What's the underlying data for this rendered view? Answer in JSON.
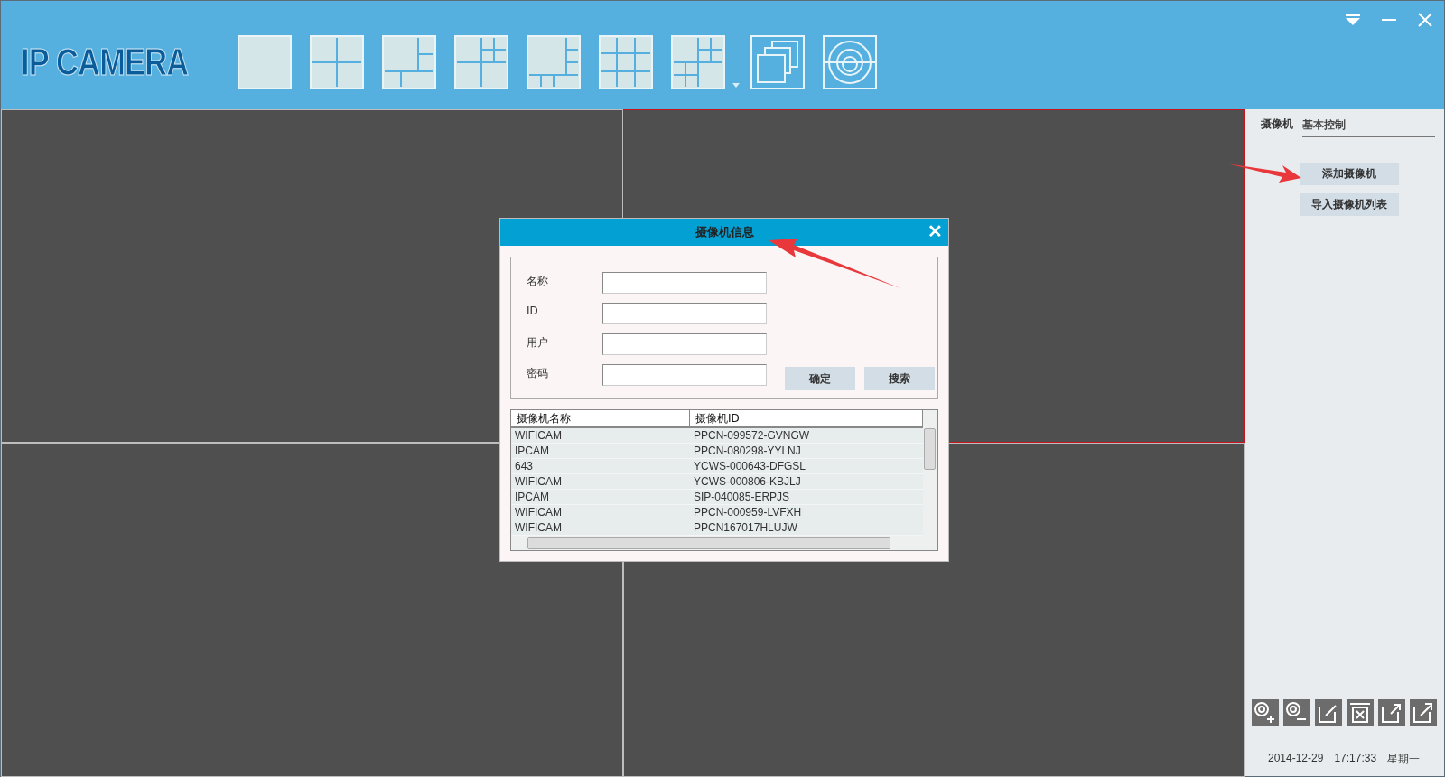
{
  "header": {
    "logo": "IP CAMERA"
  },
  "video_cells": [
    {
      "selected": false
    },
    {
      "selected": true
    },
    {
      "selected": false
    },
    {
      "selected": false
    }
  ],
  "side_panel": {
    "tabs": [
      {
        "label": "摄像机",
        "selected": true
      },
      {
        "label": "基本控制",
        "selected": false
      }
    ],
    "buttons": [
      "添加摄像机",
      "导入摄像机列表"
    ],
    "date": "2014-12-29",
    "time": "17:17:33",
    "weekday": "星期一"
  },
  "dialog": {
    "title": "摄像机信息",
    "close": "✕",
    "fields": [
      {
        "label": "名称"
      },
      {
        "label": "ID"
      },
      {
        "label": "用户"
      },
      {
        "label": "密码"
      }
    ],
    "buttons": [
      "确定",
      "搜索"
    ],
    "table": {
      "columns": [
        "摄像机名称",
        "摄像机ID"
      ],
      "rows": [
        [
          "WIFICAM",
          "PPCN-099572-GVNGW"
        ],
        [
          "IPCAM",
          "PPCN-080298-YYLNJ"
        ],
        [
          "643",
          "YCWS-000643-DFGSL"
        ],
        [
          "WIFICAM",
          "YCWS-000806-KBJLJ"
        ],
        [
          "IPCAM",
          "SIP-040085-ERPJS"
        ],
        [
          "WIFICAM",
          "PPCN-000959-LVFXH"
        ],
        [
          "WIFICAM",
          "PPCN167017HLUJW"
        ]
      ]
    }
  }
}
